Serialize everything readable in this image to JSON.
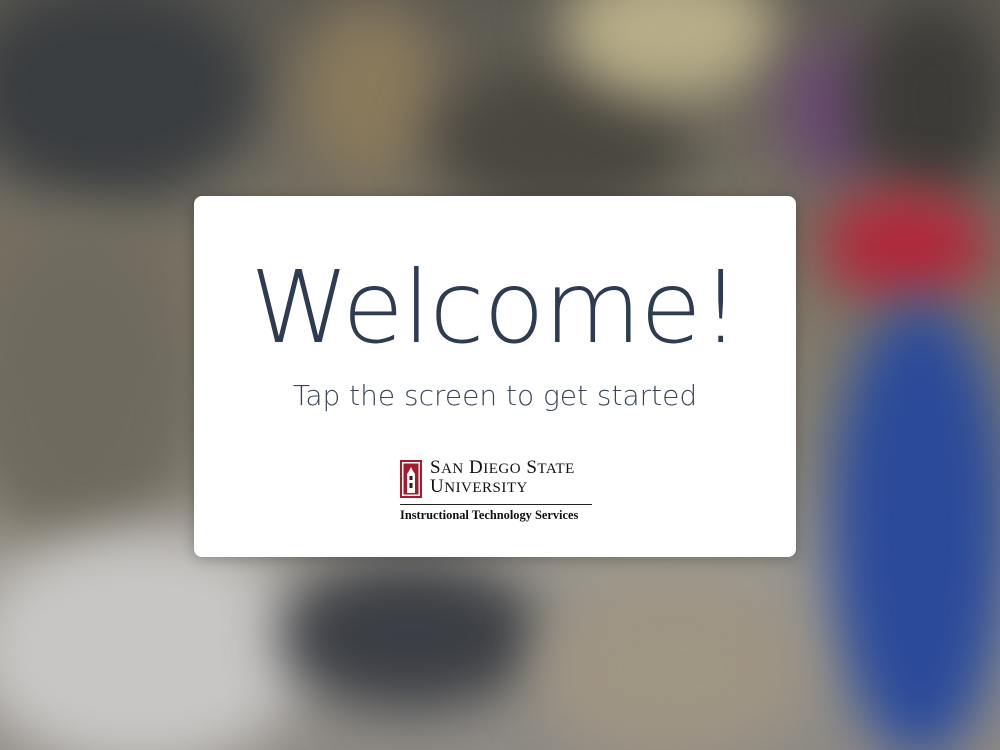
{
  "screen": {
    "title": "Welcome!",
    "subtitle": "Tap the screen to get started"
  },
  "logo": {
    "name_line1": "San Diego State",
    "name_line2": "University",
    "department": "Instructional Technology Services",
    "seal_icon": "sdsu-tower-seal-icon",
    "brand_color": "#a6192e"
  },
  "colors": {
    "title_text": "#2e3b52",
    "card_bg": "#ffffff"
  }
}
